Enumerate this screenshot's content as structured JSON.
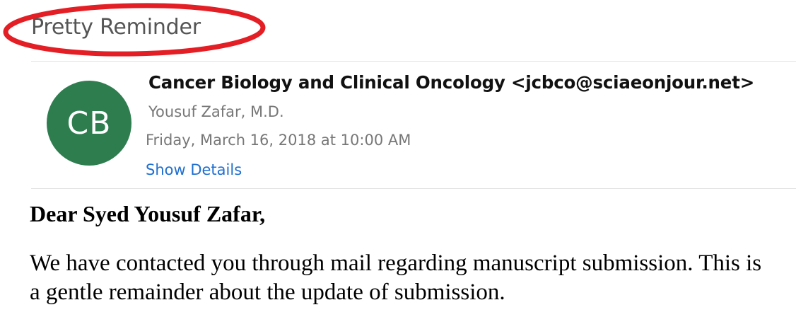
{
  "email": {
    "subject": "Pretty Reminder",
    "avatar_initials": "CB",
    "avatar_color": "#2e7d4f",
    "sender": "Cancer Biology and Clinical Oncology <jcbco@sciaeonjour.net>",
    "recipient": "Yousuf Zafar, M.D.",
    "date": "Friday, March 16, 2018 at 10:00 AM",
    "show_details_label": "Show Details"
  },
  "message": {
    "greeting": "Dear Syed Yousuf Zafar,",
    "paragraph_line1": "We have contacted you through mail regarding manuscript submission. This is",
    "paragraph_line2": "a gentle remainder about the update of submission."
  },
  "annotation": {
    "ellipse_color": "#e31e24"
  }
}
